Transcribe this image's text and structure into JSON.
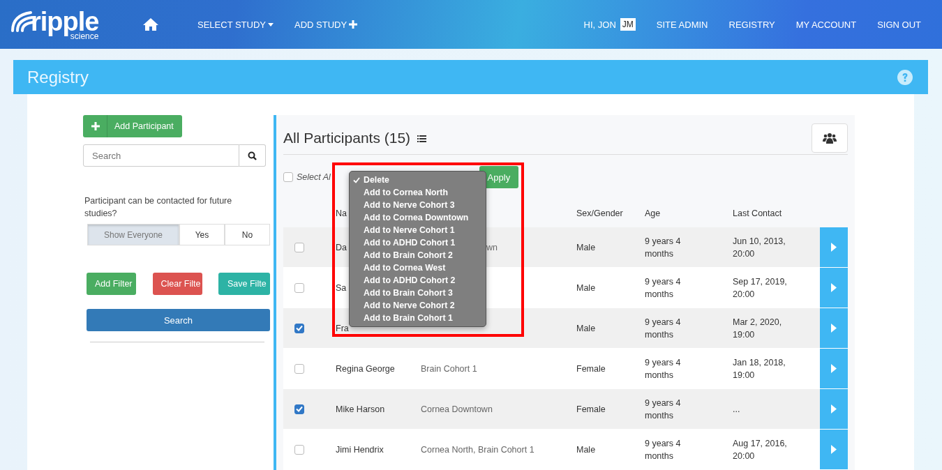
{
  "header": {
    "logo": "ripple",
    "logo_sub": "science",
    "nav": [
      {
        "label": "SELECT STUDY",
        "kind": "dropdown"
      },
      {
        "label": "ADD STUDY",
        "kind": "add"
      }
    ],
    "greeting": "HI, JON",
    "initials": "JM",
    "links": [
      "SITE ADMIN",
      "REGISTRY",
      "MY ACCOUNT",
      "SIGN OUT"
    ]
  },
  "page_title": "Registry",
  "sidebar": {
    "add_button": "Add Participant",
    "search": {
      "placeholder": "Search"
    },
    "question": "Participant can be contacted for future studies?",
    "contact_options": [
      {
        "label": "Show Everyone",
        "selected": true
      },
      {
        "label": "Yes",
        "selected": false
      },
      {
        "label": "No",
        "selected": false
      }
    ],
    "filter_buttons": [
      {
        "label": "Add Filter",
        "kind": "add"
      },
      {
        "label": "Clear Filte",
        "kind": "clear"
      },
      {
        "label": "Save Filte",
        "kind": "save"
      }
    ],
    "search_button": "Search"
  },
  "participants": {
    "title": "All Participants (15)",
    "select_all": {
      "label": "Select Al",
      "checked": false
    },
    "apply_button": "Apply",
    "columns": [
      "Na",
      "",
      "Sex/Gender",
      "Age",
      "Last Contact"
    ],
    "rows": [
      {
        "checked": false,
        "name": "Da",
        "cohorts": "wn",
        "cohorts_cut": true,
        "sex": "Male",
        "age": "9 years 4 months",
        "last_contact": "Jun 10, 2013, 20:00"
      },
      {
        "checked": false,
        "name": "Sa",
        "sex": "Male",
        "age": "9 years 4 months",
        "last_contact": "Sep 17, 2019, 20:00"
      },
      {
        "checked": true,
        "name": "Fra",
        "sex": "Male",
        "age": "9 years 4 months",
        "last_contact": "Mar 2, 2020, 19:00"
      },
      {
        "checked": false,
        "name": "Regina George",
        "cohorts": "Brain Cohort 1",
        "sex": "Female",
        "age": "9 years 4 months",
        "last_contact": "Jan 18, 2018, 19:00"
      },
      {
        "checked": true,
        "name": "Mike Harson",
        "cohorts": "Cornea Downtown",
        "sex": "Female",
        "age": "9 years 4 months",
        "last_contact": "..."
      },
      {
        "checked": false,
        "name": "Jimi Hendrix",
        "cohorts": "Cornea North, Brain Cohort 1",
        "sex": "Male",
        "age": "9 years 4 months",
        "last_contact": "Aug 17, 2016, 20:00"
      }
    ],
    "action_menu": [
      {
        "label": "Delete",
        "selected": true
      },
      {
        "label": "Add to Cornea North",
        "selected": false
      },
      {
        "label": "Add to Nerve Cohort 3",
        "selected": false
      },
      {
        "label": "Add to Cornea Downtown",
        "selected": false
      },
      {
        "label": "Add to Nerve Cohort 1",
        "selected": false
      },
      {
        "label": "Add to ADHD Cohort 1",
        "selected": false
      },
      {
        "label": "Add to Brain Cohort 2",
        "selected": false
      },
      {
        "label": "Add to Cornea West",
        "selected": false
      },
      {
        "label": "Add to ADHD Cohort 2",
        "selected": false
      },
      {
        "label": "Add to Brain Cohort 3",
        "selected": false
      },
      {
        "label": "Add to Nerve Cohort 2",
        "selected": false
      },
      {
        "label": "Add to Brain Cohort 1",
        "selected": false
      }
    ]
  }
}
